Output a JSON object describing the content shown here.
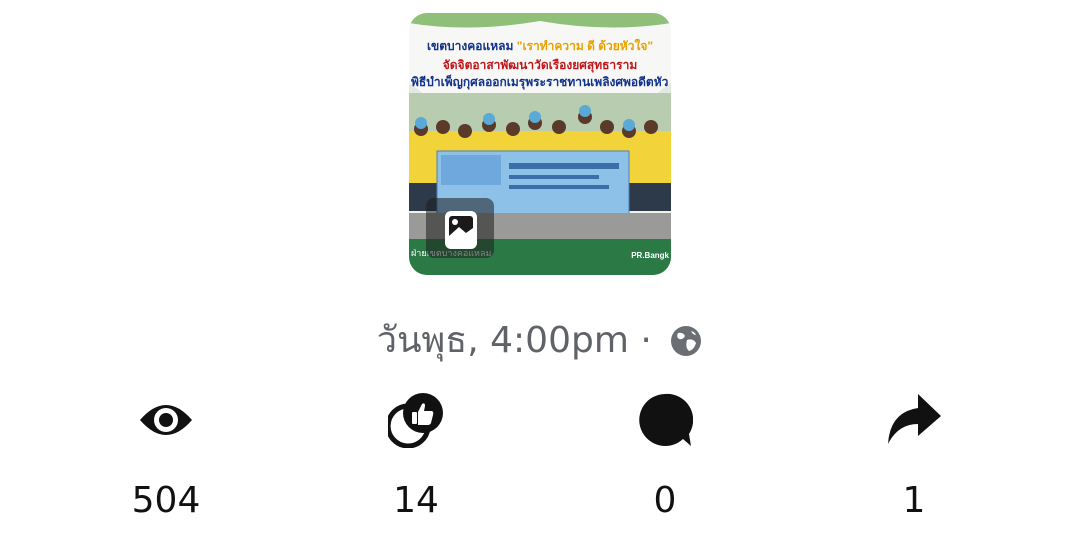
{
  "photo": {
    "headline_line1_a": "เขตบางคอแหลม ",
    "headline_line1_b": "\"เราทำความ ดี ด้วยหัวใจ\"",
    "headline_line2": "จัดจิตอาสาพัฒนาวัดเรืองยศสุทธาราม",
    "headline_line3": "พิธีบำเพ็ญกุศลออกเมรุพระราชทานเพลิงศพอดีตหัว",
    "footer_left": "ฝ่ายเขตบางคอแหลม",
    "footer_right": "PR.Bangk",
    "badge_icon": "image-gallery-icon"
  },
  "post": {
    "timestamp": "วันพุธ, 4:00pm ·",
    "privacy_icon": "globe-icon"
  },
  "stats": {
    "views": {
      "icon": "eye-icon",
      "count": "504"
    },
    "reactions": {
      "icon": "like-reaction-icon",
      "count": "14"
    },
    "comments": {
      "icon": "comment-bubble-icon",
      "count": "0"
    },
    "shares": {
      "icon": "share-arrow-icon",
      "count": "1"
    }
  },
  "colors": {
    "stat_icon": "#111111",
    "timestamp_text": "#5f6368",
    "photo_footer": "#2b7a46",
    "shirt_yellow": "#f2d43a",
    "banner_blue": "#6fa8dc"
  }
}
